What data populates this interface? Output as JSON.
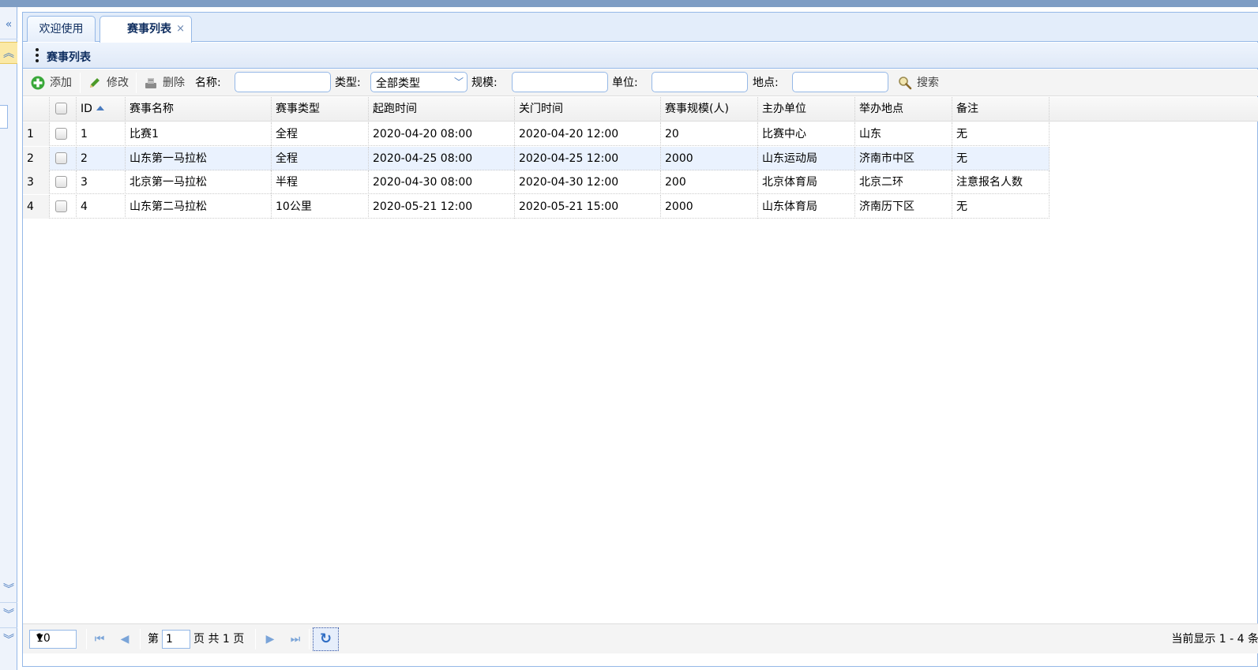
{
  "tabs": [
    {
      "label": "欢迎使用"
    },
    {
      "label": "赛事列表",
      "close": "×"
    }
  ],
  "panel": {
    "title": "赛事列表"
  },
  "toolbar": {
    "add_label": "添加",
    "edit_label": "修改",
    "delete_label": "删除",
    "name_label": "名称:",
    "name_value": "",
    "type_label": "类型:",
    "type_selected": "全部类型",
    "scale_label": "规模:",
    "scale_value": "",
    "unit_label": "单位:",
    "unit_value": "",
    "place_label": "地点:",
    "place_value": "",
    "search_label": "搜索"
  },
  "grid": {
    "columns": [
      "ID",
      "赛事名称",
      "赛事类型",
      "起跑时间",
      "关门时间",
      "赛事规模(人)",
      "主办单位",
      "举办地点",
      "备注"
    ],
    "rows": [
      {
        "num": "1",
        "id": "1",
        "name": "比赛1",
        "type": "全程",
        "start": "2020-04-20 08:00",
        "close": "2020-04-20 12:00",
        "scale": "20",
        "org": "比赛中心",
        "place": "山东",
        "note": "无"
      },
      {
        "num": "2",
        "id": "2",
        "name": "山东第一马拉松",
        "type": "全程",
        "start": "2020-04-25 08:00",
        "close": "2020-04-25 12:00",
        "scale": "2000",
        "org": "山东运动局",
        "place": "济南市中区",
        "note": "无"
      },
      {
        "num": "3",
        "id": "3",
        "name": "北京第一马拉松",
        "type": "半程",
        "start": "2020-04-30 08:00",
        "close": "2020-04-30 12:00",
        "scale": "200",
        "org": "北京体育局",
        "place": "北京二环",
        "note": "注意报名人数"
      },
      {
        "num": "4",
        "id": "4",
        "name": "山东第二马拉松",
        "type": "10公里",
        "start": "2020-05-21 12:00",
        "close": "2020-05-21 15:00",
        "scale": "2000",
        "org": "山东体育局",
        "place": "济南历下区",
        "note": "无"
      }
    ]
  },
  "pager": {
    "page_size": "10",
    "page_prefix": "第",
    "page_value": "1",
    "page_suffix": "页 共 1 页",
    "info": "当前显示 1 - 4 条"
  },
  "colors": {
    "accent": "#95b8e7",
    "header_bar": "#7e9dc4",
    "selected_row": "#eaf2fe"
  },
  "icons": [
    "add-icon",
    "edit-icon",
    "delete-icon",
    "search-icon",
    "first-page-icon",
    "prev-page-icon",
    "next-page-icon",
    "last-page-icon",
    "refresh-icon"
  ]
}
